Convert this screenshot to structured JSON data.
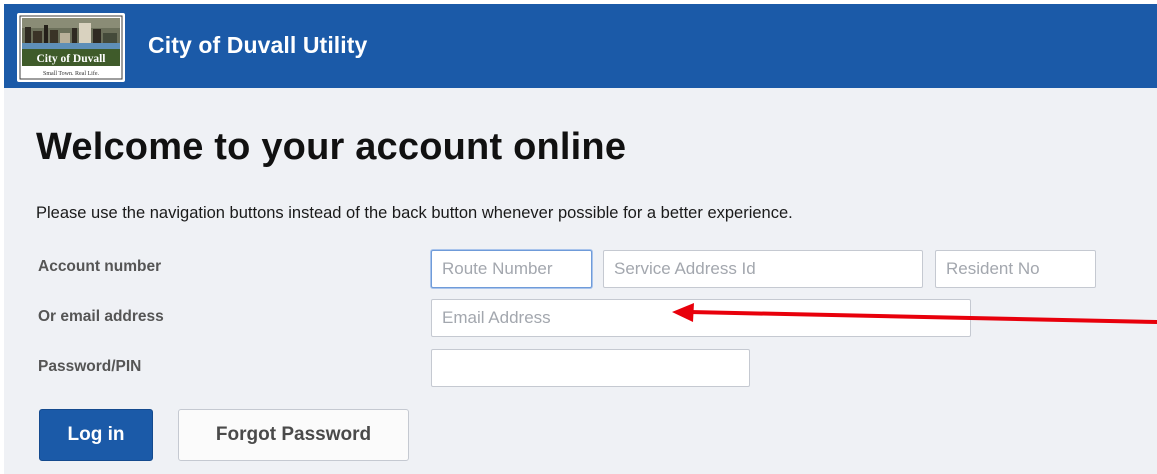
{
  "header": {
    "title": "City of Duvall Utility",
    "logo": {
      "name": "City of Duvall",
      "tagline": "Small Town. Real Life."
    }
  },
  "main": {
    "heading": "Welcome to your account online",
    "notice": "Please use the navigation buttons instead of the back button whenever possible for a better experience."
  },
  "form": {
    "account_label": "Account number",
    "route_placeholder": "Route Number",
    "service_address_placeholder": "Service Address Id",
    "resident_placeholder": "Resident No",
    "email_label": "Or email address",
    "email_placeholder": "Email Address",
    "password_label": "Password/PIN",
    "password_value": ""
  },
  "actions": {
    "login_label": "Log in",
    "forgot_label": "Forgot Password"
  },
  "colors": {
    "brand": "#1b5aa8",
    "background": "#eff1f5",
    "annotation_arrow": "#e8000b"
  }
}
